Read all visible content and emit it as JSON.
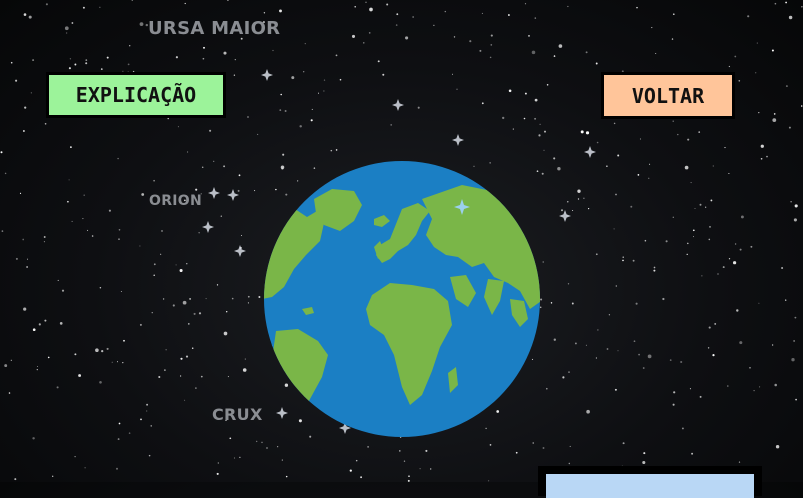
{
  "constellations": {
    "ursa_maior": "URSA MAIOR",
    "orion": "ORION",
    "crux": "CRUX"
  },
  "buttons": {
    "explicacao": "EXPLICAÇÃO",
    "voltar": "VOLTAR"
  },
  "colors": {
    "explicacao_bg": "#9cf39a",
    "voltar_bg": "#ffc59a",
    "ocean": "#1b7fc4",
    "land": "#7ab648",
    "panel": "#b9d7f5"
  }
}
